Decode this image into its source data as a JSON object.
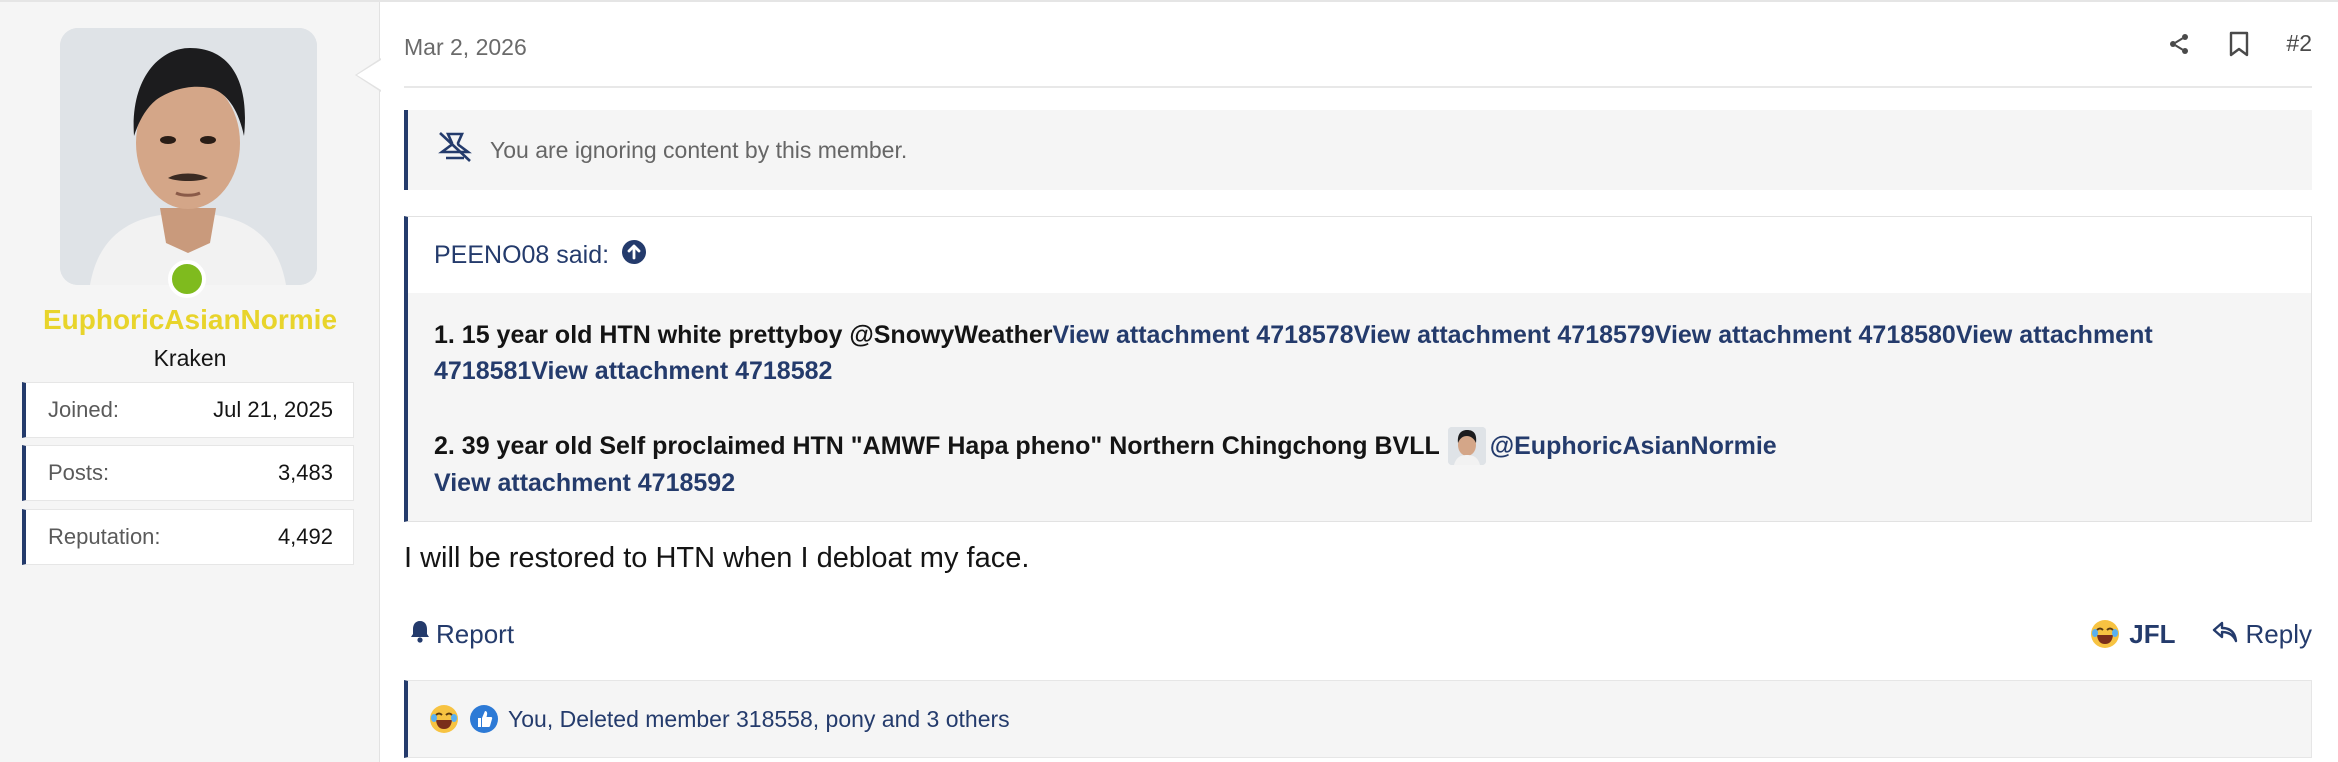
{
  "user": {
    "username": "EuphoricAsianNormie",
    "title": "Kraken",
    "stats": [
      {
        "label": "Joined:",
        "value": "Jul 21, 2025"
      },
      {
        "label": "Posts:",
        "value": "3,483"
      },
      {
        "label": "Reputation:",
        "value": "4,492"
      }
    ],
    "online": true
  },
  "post": {
    "date": "Mar 2, 2026",
    "number": "#2",
    "ignored_notice": "You are ignoring content by this member.",
    "quote": {
      "author_said": "PEENO08 said:",
      "line1_text": "1. 15 year old HTN white prettyboy @SnowyWeather",
      "line1_links": [
        "View attachment 4718578",
        "View attachment 4718579",
        "View attachment 4718580",
        "View attachment 4718581",
        "View attachment 4718582"
      ],
      "line2_text": "2. 39 year old Self proclaimed HTN \"AMWF Hapa pheno\" Northern Chingchong BVLL",
      "line2_mention": "@EuphoricAsianNormie",
      "line2_link": "View attachment 4718592"
    },
    "body": "I will be restored to HTN when I debloat my face.",
    "actions": {
      "report": "Report",
      "reaction": "JFL",
      "reply": "Reply"
    },
    "reactions_summary": "You, Deleted member 318558, pony and 3 others"
  },
  "colors": {
    "accent": "#243b6c",
    "username": "#e8d42b",
    "online": "#7fbb1e"
  },
  "icons": [
    "share-icon",
    "bookmark-icon",
    "ignored-user-icon",
    "arrow-up-circle-icon",
    "bell-icon",
    "laughing-emoji-icon",
    "reply-icon",
    "thumbs-up-icon"
  ]
}
